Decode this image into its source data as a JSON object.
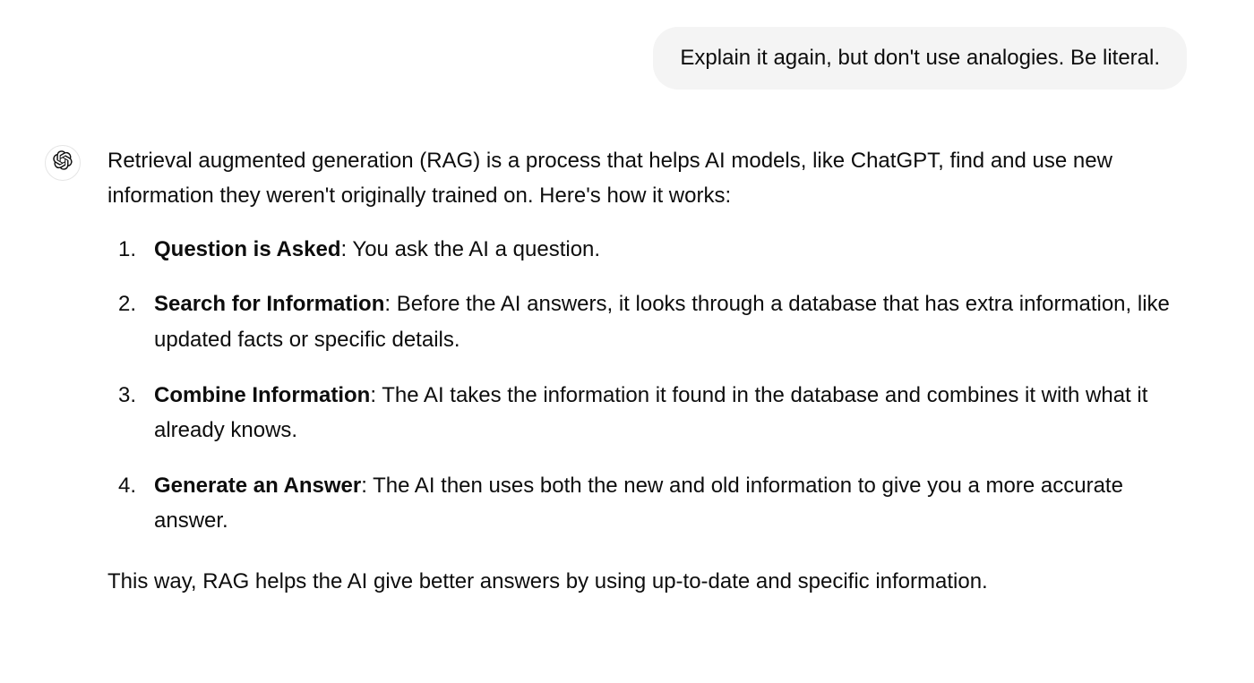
{
  "user_message": {
    "text": "Explain it again, but don't use analogies. Be literal."
  },
  "assistant_message": {
    "intro": "Retrieval augmented generation (RAG) is a process that helps AI models, like ChatGPT, find and use new information they weren't originally trained on. Here's how it works:",
    "steps": [
      {
        "title": "Question is Asked",
        "body": ": You ask the AI a question."
      },
      {
        "title": "Search for Information",
        "body": ": Before the AI answers, it looks through a database that has extra information, like updated facts or specific details."
      },
      {
        "title": "Combine Information",
        "body": ": The AI takes the information it found in the database and combines it with what it already knows."
      },
      {
        "title": "Generate an Answer",
        "body": ": The AI then uses both the new and old information to give you a more accurate answer."
      }
    ],
    "closing": "This way, RAG helps the AI give better answers by using up-to-date and specific information."
  }
}
